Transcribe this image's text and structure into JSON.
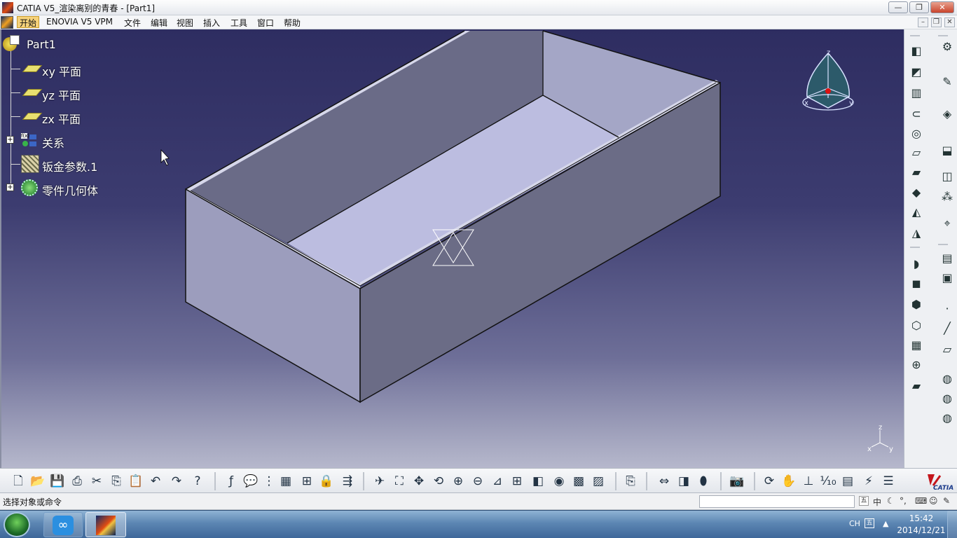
{
  "window": {
    "title": "CATIA V5_渲染离别的青春 - [Part1]",
    "min_label": "—",
    "max_label": "❐",
    "close_label": "✕"
  },
  "menu": {
    "items": [
      "开始",
      "ENOVIA V5 VPM",
      "文件",
      "编辑",
      "视图",
      "插入",
      "工具",
      "窗口",
      "帮助"
    ],
    "active": "开始"
  },
  "tree": {
    "root": "Part1",
    "items": [
      {
        "label": "xy 平面",
        "icon": "plane-icon",
        "expandable": false
      },
      {
        "label": "yz 平面",
        "icon": "plane-icon",
        "expandable": false
      },
      {
        "label": "zx 平面",
        "icon": "plane-icon",
        "expandable": false
      },
      {
        "label": "关系",
        "icon": "relations-icon",
        "expandable": true
      },
      {
        "label": "钣金参数.1",
        "icon": "sheetmetal-params-icon",
        "expandable": false
      },
      {
        "label": "零件几何体",
        "icon": "part-body-icon",
        "expandable": true
      }
    ]
  },
  "compass": {
    "x": "x",
    "y": "y",
    "z": "z"
  },
  "axis_triad": {
    "x": "x",
    "y": "y",
    "z": "z"
  },
  "status": {
    "prompt": "选择对象或命令",
    "command_value": ""
  },
  "ime_bar": {
    "lang": "中"
  },
  "taskbar": {
    "lang": "CH",
    "time": "15:42",
    "date": "2014/12/21"
  },
  "colors": {
    "viewport_top": "#2e2d61",
    "viewport_bottom": "#b6b8cc",
    "model_face": "#9a9cbc",
    "menu_active": "#f6d27a"
  }
}
